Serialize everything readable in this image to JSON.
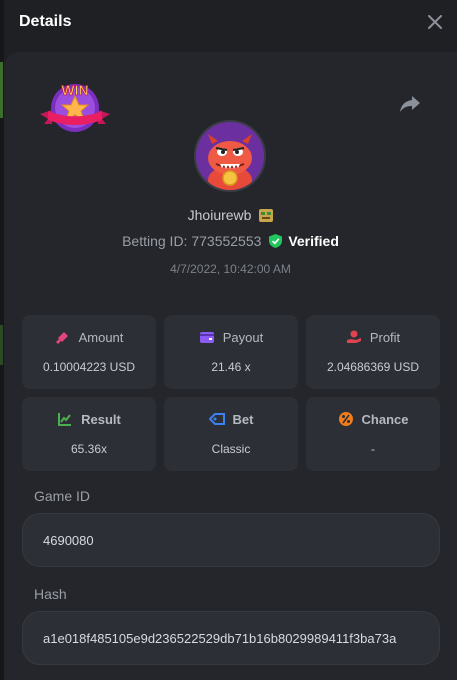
{
  "header": {
    "title": "Details"
  },
  "user": {
    "name": "Jhoiurewb"
  },
  "badge": {
    "text": "WIN"
  },
  "bet_info": {
    "betting_label": "Betting ID:",
    "betting_id": "773552553",
    "verified_label": "Verified",
    "datetime": "4/7/2022, 10:42:00 AM"
  },
  "stats": [
    {
      "label": "Amount",
      "value": "0.10004223 USD",
      "icon": "coins-icon",
      "color": "#e0457b"
    },
    {
      "label": "Payout",
      "value": "21.46 x",
      "icon": "wallet-icon",
      "color": "#8b5cf6"
    },
    {
      "label": "Profit",
      "value": "2.04686369 USD",
      "icon": "hand-money-icon",
      "color": "#e0454f"
    },
    {
      "label": "Result",
      "value": "65.36x",
      "icon": "chart-icon",
      "color": "#4caf50"
    },
    {
      "label": "Bet",
      "value": "Classic",
      "icon": "tag-icon",
      "color": "#3b82f6"
    },
    {
      "label": "Chance",
      "value": "-",
      "icon": "percent-icon",
      "color": "#f07d1a"
    }
  ],
  "game": {
    "label": "Game ID",
    "value": "4690080"
  },
  "hash": {
    "label": "Hash",
    "value": "a1e018f485105e9d236522529db71b16b8029989411f3ba73a"
  }
}
